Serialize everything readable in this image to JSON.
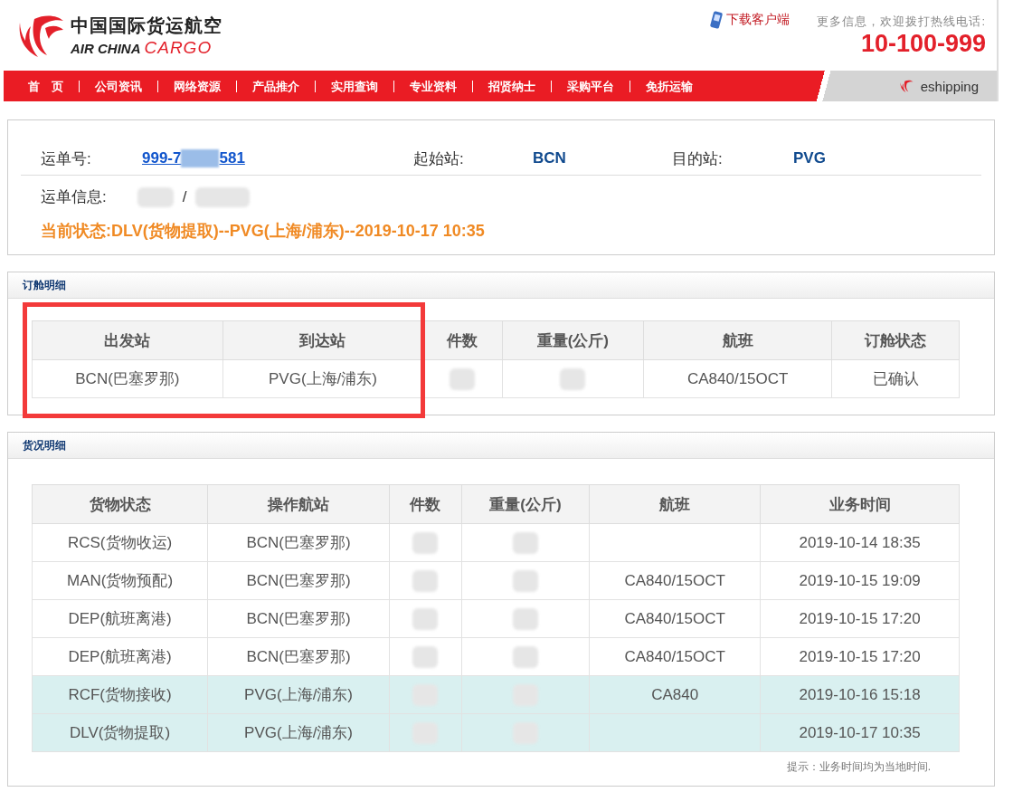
{
  "header": {
    "brand_cn": "中国国际货运航空",
    "brand_en": "AIR CHINA",
    "brand_cargo": "CARGO",
    "download": "下载客户端",
    "hotline_label": "更多信息，欢迎拨打热线电话:",
    "hotline": "10-100-999"
  },
  "nav": {
    "items": [
      "首　页",
      "公司资讯",
      "网络资源",
      "产品推介",
      "实用查询",
      "专业资料",
      "招贤纳士",
      "采购平台",
      "免折运输"
    ],
    "eshipping": "eshipping"
  },
  "waybill": {
    "label": "运单号:",
    "prefix": "999-7",
    "suffix": "581",
    "origin_label": "起始站:",
    "origin": "BCN",
    "dest_label": "目的站:",
    "dest": "PVG",
    "info_label": "运单信息:",
    "info_separator": "/",
    "status": "当前状态:DLV(货物提取)--PVG(上海/浦东)--2019-10-17 10:35"
  },
  "booking": {
    "title": "订舱明细",
    "annotation": {
      "kind": "frame"
    },
    "columns": [
      {
        "label": "出发站"
      },
      {
        "label": "到达站"
      },
      {
        "label": "件数"
      },
      {
        "label": "重量(公斤)"
      },
      {
        "label": "航班"
      },
      {
        "label": "订舱状态"
      }
    ],
    "rows": [
      {
        "cells": [
          {
            "kind": "text",
            "text": "BCN(巴塞罗那)"
          },
          {
            "kind": "text",
            "text": "PVG(上海/浦东)"
          },
          {
            "kind": "redacted"
          },
          {
            "kind": "redacted"
          },
          {
            "kind": "text",
            "text": "CA840/15OCT"
          },
          {
            "kind": "text",
            "text": "已确认"
          }
        ]
      }
    ]
  },
  "cargo": {
    "title": "货况明细",
    "columns": [
      "货物状态",
      "操作航站",
      "件数",
      "重量(公斤)",
      "航班",
      "业务时间"
    ],
    "rows": [
      {
        "highlighted": false,
        "cells": [
          {
            "kind": "text",
            "text": "RCS(货物收运)"
          },
          {
            "kind": "text",
            "text": "BCN(巴塞罗那)"
          },
          {
            "kind": "redacted"
          },
          {
            "kind": "redacted"
          },
          {
            "kind": "blank"
          },
          {
            "kind": "text",
            "text": "2019-10-14 18:35"
          }
        ]
      },
      {
        "highlighted": false,
        "cells": [
          {
            "kind": "text",
            "text": "MAN(货物预配)"
          },
          {
            "kind": "text",
            "text": "BCN(巴塞罗那)"
          },
          {
            "kind": "redacted"
          },
          {
            "kind": "redacted"
          },
          {
            "kind": "text",
            "text": "CA840/15OCT"
          },
          {
            "kind": "text",
            "text": "2019-10-15 19:09"
          }
        ]
      },
      {
        "highlighted": false,
        "cells": [
          {
            "kind": "text",
            "text": "DEP(航班离港)"
          },
          {
            "kind": "text",
            "text": "BCN(巴塞罗那)"
          },
          {
            "kind": "redacted"
          },
          {
            "kind": "redacted"
          },
          {
            "kind": "text",
            "text": "CA840/15OCT"
          },
          {
            "kind": "text",
            "text": "2019-10-15 17:20"
          }
        ]
      },
      {
        "highlighted": false,
        "cells": [
          {
            "kind": "text",
            "text": "DEP(航班离港)"
          },
          {
            "kind": "text",
            "text": "BCN(巴塞罗那)"
          },
          {
            "kind": "redacted"
          },
          {
            "kind": "redacted"
          },
          {
            "kind": "text",
            "text": "CA840/15OCT"
          },
          {
            "kind": "text",
            "text": "2019-10-15 17:20"
          }
        ]
      },
      {
        "highlighted": true,
        "cells": [
          {
            "kind": "text",
            "text": "RCF(货物接收)"
          },
          {
            "kind": "text",
            "text": "PVG(上海/浦东)"
          },
          {
            "kind": "redacted"
          },
          {
            "kind": "redacted"
          },
          {
            "kind": "text",
            "text": "CA840"
          },
          {
            "kind": "text",
            "text": "2019-10-16 15:18"
          }
        ]
      },
      {
        "highlighted": true,
        "cells": [
          {
            "kind": "text",
            "text": "DLV(货物提取)"
          },
          {
            "kind": "text",
            "text": "PVG(上海/浦东)"
          },
          {
            "kind": "redacted"
          },
          {
            "kind": "redacted"
          },
          {
            "kind": "blank"
          },
          {
            "kind": "text",
            "text": "2019-10-17 10:35"
          }
        ]
      }
    ],
    "note": "提示：业务时间均为当地时间."
  }
}
